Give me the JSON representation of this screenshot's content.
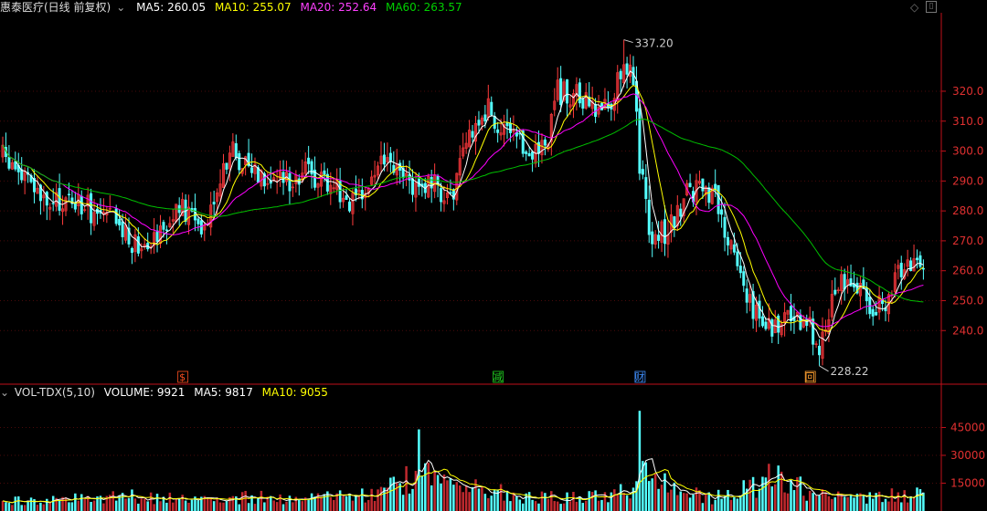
{
  "header": {
    "title": "惠泰医疗(日线 前复权)",
    "dropdown_icon": "chevron-down-icon",
    "ma5": "MA5: 260.05",
    "ma10": "MA10: 255.07",
    "ma20": "MA20: 252.64",
    "ma60": "MA60: 263.57"
  },
  "volume_header": {
    "indicator": "VOL-TDX(5,10)",
    "volume": "VOLUME: 9921",
    "ma5": "MA5: 9817",
    "ma10": "MA10: 9055"
  },
  "colors": {
    "up": "#ff3c3c",
    "up_body": "#c0292e",
    "down": "#54ffff",
    "ma5": "#ffffff",
    "ma10": "#ffff00",
    "ma20": "#ff00ff",
    "ma60": "#00c000",
    "axis": "#c0101a",
    "grid": "#4a0a0a"
  },
  "toolbar": {
    "diamond_icon": "diamond-icon",
    "panel_icon": "window-toggle-icon"
  },
  "markers": [
    {
      "label": "$",
      "day": 57,
      "color": "#ff5020"
    },
    {
      "label": "减",
      "day": 157,
      "color": "#20d020"
    },
    {
      "label": "财",
      "day": 202,
      "color": "#4090ff"
    },
    {
      "label": "回",
      "day": 256,
      "color": "#ffa030"
    }
  ],
  "annotations": {
    "high_label": "337.20",
    "low_label": "228.22"
  },
  "chart_data": {
    "type": "candlestick",
    "price_axis": {
      "ticks": [
        240,
        250,
        260,
        270,
        280,
        290,
        300,
        310,
        320
      ],
      "tick_labels": [
        "240.0",
        "250.0",
        "260.0",
        "270.0",
        "280.0",
        "290.0",
        "300.0",
        "310.0",
        "320.0"
      ],
      "range": [
        223,
        345
      ]
    },
    "volume_axis": {
      "ticks": [
        15000,
        30000,
        45000
      ],
      "tick_labels": [
        "15000",
        "30000",
        "45000"
      ],
      "range": [
        0,
        60000
      ]
    },
    "high": {
      "day": 197,
      "value": 337.2
    },
    "low": {
      "day": 259,
      "value": 228.22
    },
    "anchors": [
      [
        0,
        298
      ],
      [
        8,
        290
      ],
      [
        14,
        281
      ],
      [
        22,
        284
      ],
      [
        30,
        279
      ],
      [
        36,
        276
      ],
      [
        42,
        269
      ],
      [
        50,
        274
      ],
      [
        56,
        280
      ],
      [
        64,
        276
      ],
      [
        72,
        300
      ],
      [
        80,
        294
      ],
      [
        88,
        290
      ],
      [
        96,
        293
      ],
      [
        104,
        290
      ],
      [
        112,
        281
      ],
      [
        120,
        297
      ],
      [
        128,
        290
      ],
      [
        136,
        288
      ],
      [
        143,
        286
      ],
      [
        149,
        308
      ],
      [
        154,
        314
      ],
      [
        160,
        304
      ],
      [
        166,
        300
      ],
      [
        172,
        302
      ],
      [
        176,
        320
      ],
      [
        182,
        318
      ],
      [
        188,
        313
      ],
      [
        193,
        317
      ],
      [
        197,
        331
      ],
      [
        200,
        325
      ],
      [
        202,
        295
      ],
      [
        206,
        270
      ],
      [
        212,
        275
      ],
      [
        218,
        288
      ],
      [
        226,
        283
      ],
      [
        232,
        264
      ],
      [
        238,
        248
      ],
      [
        242,
        241
      ],
      [
        248,
        244
      ],
      [
        254,
        243
      ],
      [
        259,
        236
      ],
      [
        262,
        248
      ],
      [
        266,
        259
      ],
      [
        270,
        254
      ],
      [
        276,
        249
      ],
      [
        280,
        246
      ],
      [
        284,
        261
      ],
      [
        288,
        262
      ],
      [
        292,
        264
      ]
    ],
    "volume_anchors": [
      [
        0,
        5000
      ],
      [
        20,
        6500
      ],
      [
        40,
        8000
      ],
      [
        60,
        6000
      ],
      [
        80,
        7500
      ],
      [
        100,
        7000
      ],
      [
        120,
        9000
      ],
      [
        132,
        21000
      ],
      [
        140,
        14000
      ],
      [
        150,
        12000
      ],
      [
        165,
        8000
      ],
      [
        185,
        7000
      ],
      [
        200,
        12000
      ],
      [
        205,
        24000
      ],
      [
        215,
        11000
      ],
      [
        225,
        7000
      ],
      [
        240,
        14000
      ],
      [
        245,
        19000
      ],
      [
        255,
        11000
      ],
      [
        270,
        6500
      ],
      [
        292,
        9921
      ]
    ],
    "volume_spikes": [
      {
        "day": 132,
        "value": 44000
      },
      {
        "day": 202,
        "value": 54000
      }
    ],
    "series": [
      {
        "name": "MA5",
        "period": 5,
        "color": "#ffffff"
      },
      {
        "name": "MA10",
        "period": 10,
        "color": "#ffff00"
      },
      {
        "name": "MA20",
        "period": 20,
        "color": "#ff00ff"
      },
      {
        "name": "MA60",
        "period": 60,
        "color": "#00c000"
      }
    ],
    "days": 293,
    "grid": true
  }
}
